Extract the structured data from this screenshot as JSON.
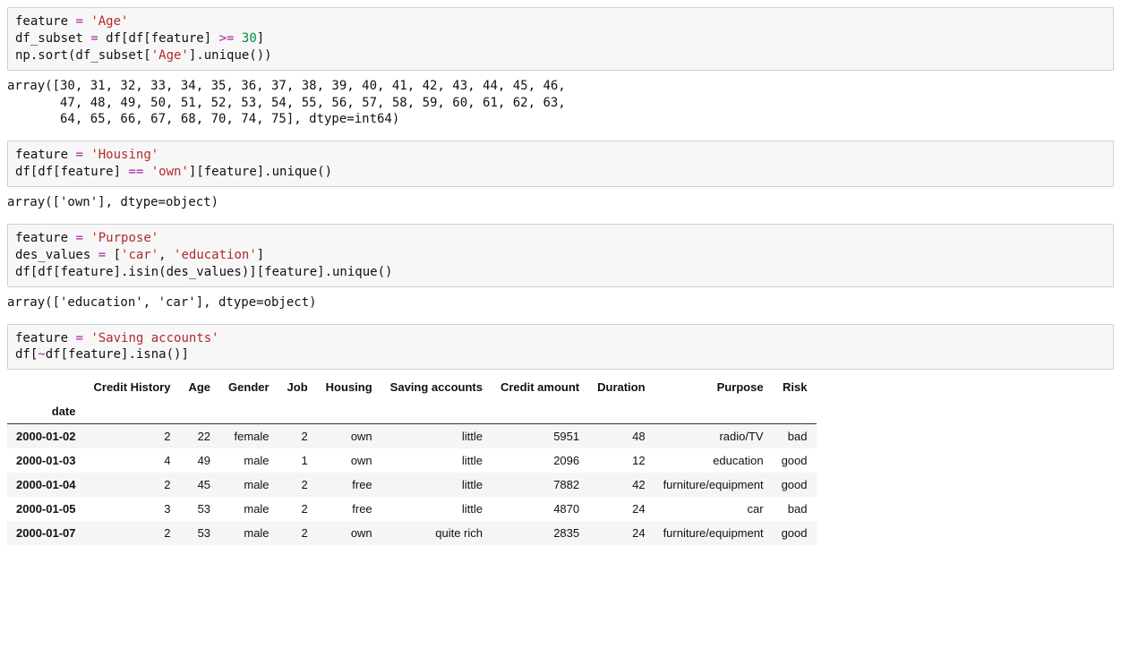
{
  "cells": [
    {
      "code_tokens": [
        [
          [
            "",
            "feature "
          ],
          [
            "op",
            "="
          ],
          [
            "",
            " "
          ],
          [
            "str",
            "'Age'"
          ]
        ],
        [
          [
            "",
            "df_subset "
          ],
          [
            "op",
            "="
          ],
          [
            "",
            " df[df[feature] "
          ],
          [
            "op",
            ">="
          ],
          [
            "",
            " "
          ],
          [
            "num",
            "30"
          ],
          [
            "",
            "]"
          ]
        ],
        [
          [
            "",
            "np.sort(df_subset["
          ],
          [
            "str",
            "'Age'"
          ],
          [
            "",
            "].unique())"
          ]
        ]
      ],
      "output": "array([30, 31, 32, 33, 34, 35, 36, 37, 38, 39, 40, 41, 42, 43, 44, 45, 46,\n       47, 48, 49, 50, 51, 52, 53, 54, 55, 56, 57, 58, 59, 60, 61, 62, 63,\n       64, 65, 66, 67, 68, 70, 74, 75], dtype=int64)"
    },
    {
      "code_tokens": [
        [
          [
            "",
            "feature "
          ],
          [
            "op",
            "="
          ],
          [
            "",
            " "
          ],
          [
            "str",
            "'Housing'"
          ]
        ],
        [
          [
            "",
            "df[df[feature] "
          ],
          [
            "op",
            "=="
          ],
          [
            "",
            " "
          ],
          [
            "str",
            "'own'"
          ],
          [
            "",
            "][feature].unique()"
          ]
        ]
      ],
      "output": "array(['own'], dtype=object)"
    },
    {
      "code_tokens": [
        [
          [
            "",
            "feature "
          ],
          [
            "op",
            "="
          ],
          [
            "",
            " "
          ],
          [
            "str",
            "'Purpose'"
          ]
        ],
        [
          [
            "",
            "des_values "
          ],
          [
            "op",
            "="
          ],
          [
            "",
            " ["
          ],
          [
            "str",
            "'car'"
          ],
          [
            "",
            ", "
          ],
          [
            "str",
            "'education'"
          ],
          [
            "",
            "]"
          ]
        ],
        [
          [
            "",
            "df[df[feature].isin(des_values)][feature].unique()"
          ]
        ]
      ],
      "output": "array(['education', 'car'], dtype=object)"
    },
    {
      "code_tokens": [
        [
          [
            "",
            "feature "
          ],
          [
            "op",
            "="
          ],
          [
            "",
            " "
          ],
          [
            "str",
            "'Saving accounts'"
          ]
        ],
        [
          [
            "",
            "df["
          ],
          [
            "op",
            "~"
          ],
          [
            "",
            "df[feature].isna()]"
          ]
        ]
      ],
      "dataframe": {
        "index_name": "date",
        "columns": [
          "Credit History",
          "Age",
          "Gender",
          "Job",
          "Housing",
          "Saving accounts",
          "Credit amount",
          "Duration",
          "Purpose",
          "Risk"
        ],
        "rows": [
          {
            "idx": "2000-01-02",
            "vals": [
              "2",
              "22",
              "female",
              "2",
              "own",
              "little",
              "5951",
              "48",
              "radio/TV",
              "bad"
            ]
          },
          {
            "idx": "2000-01-03",
            "vals": [
              "4",
              "49",
              "male",
              "1",
              "own",
              "little",
              "2096",
              "12",
              "education",
              "good"
            ]
          },
          {
            "idx": "2000-01-04",
            "vals": [
              "2",
              "45",
              "male",
              "2",
              "free",
              "little",
              "7882",
              "42",
              "furniture/equipment",
              "good"
            ]
          },
          {
            "idx": "2000-01-05",
            "vals": [
              "3",
              "53",
              "male",
              "2",
              "free",
              "little",
              "4870",
              "24",
              "car",
              "bad"
            ]
          },
          {
            "idx": "2000-01-07",
            "vals": [
              "2",
              "53",
              "male",
              "2",
              "own",
              "quite rich",
              "2835",
              "24",
              "furniture/equipment",
              "good"
            ]
          }
        ]
      }
    }
  ]
}
